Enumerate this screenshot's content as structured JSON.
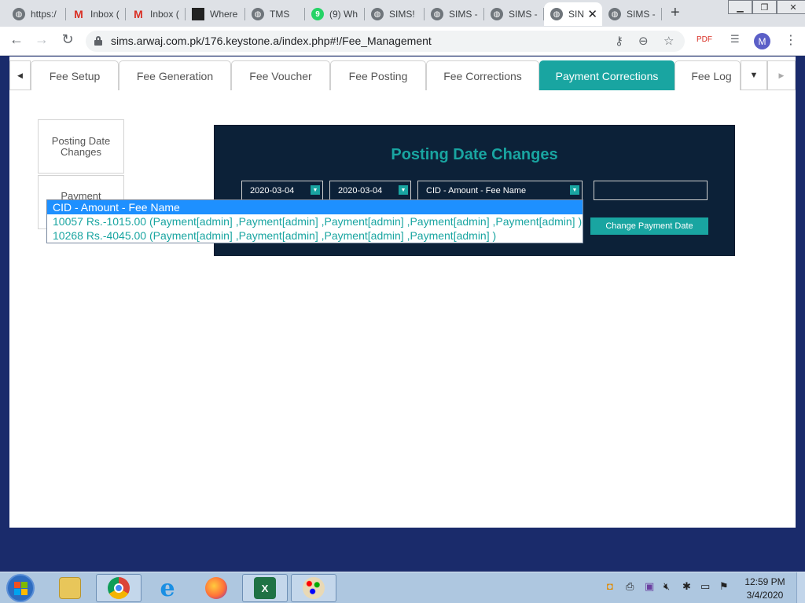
{
  "browser": {
    "tabs": [
      {
        "label": "https:/",
        "icon": "globe-icon"
      },
      {
        "label": "Inbox (",
        "icon": "gmail-icon"
      },
      {
        "label": "Inbox (",
        "icon": "gmail-icon"
      },
      {
        "label": "Where",
        "icon": "image-icon"
      },
      {
        "label": "TMS",
        "icon": "globe-icon"
      },
      {
        "label": "(9) Wh",
        "icon": "whatsapp-icon",
        "badge": "9"
      },
      {
        "label": "SIMS!",
        "icon": "globe-icon"
      },
      {
        "label": "SIMS -",
        "icon": "globe-icon"
      },
      {
        "label": "SIMS -",
        "icon": "globe-icon"
      },
      {
        "label": "SIN",
        "icon": "globe-icon",
        "active": true
      },
      {
        "label": "SIMS -",
        "icon": "globe-icon"
      }
    ],
    "new_tab": "+",
    "url": "sims.arwaj.com.pk/176.keystone.a/index.php#!/Fee_Management",
    "profile_initial": "M"
  },
  "app": {
    "subtabs": [
      {
        "label": "Fee Setup"
      },
      {
        "label": "Fee Generation"
      },
      {
        "label": "Fee Voucher"
      },
      {
        "label": "Fee Posting"
      },
      {
        "label": "Fee Corrections"
      },
      {
        "label": "Payment Corrections",
        "active": true
      },
      {
        "label": "Fee Log"
      }
    ],
    "sidebar": [
      {
        "label": "Posting Date Changes"
      },
      {
        "label": "Payment"
      }
    ],
    "panel": {
      "title": "Posting Date Changes",
      "date_from": "2020-03-04",
      "date_to": "2020-03-04",
      "cid_select": "CID - Amount - Fee Name",
      "new_date_value": "",
      "change_button": "Change Payment Date"
    },
    "dropdown_options": [
      "CID - Amount - Fee Name",
      "10057 Rs.-1015.00 (Payment[admin] ,Payment[admin] ,Payment[admin] ,Payment[admin] ,Payment[admin] )",
      "10268 Rs.-4045.00 (Payment[admin] ,Payment[admin] ,Payment[admin] ,Payment[admin] )"
    ],
    "colors": {
      "accent": "#19a5a1",
      "panel": "#0c2138",
      "highlight": "#1e90ff",
      "desktop": "#1a2b6b"
    }
  },
  "taskbar": {
    "apps": [
      "explorer-icon",
      "chrome-icon",
      "ie-icon",
      "firefox-icon",
      "excel-icon",
      "paint-icon"
    ],
    "clock_time": "12:59 PM",
    "clock_date": "3/4/2020"
  }
}
